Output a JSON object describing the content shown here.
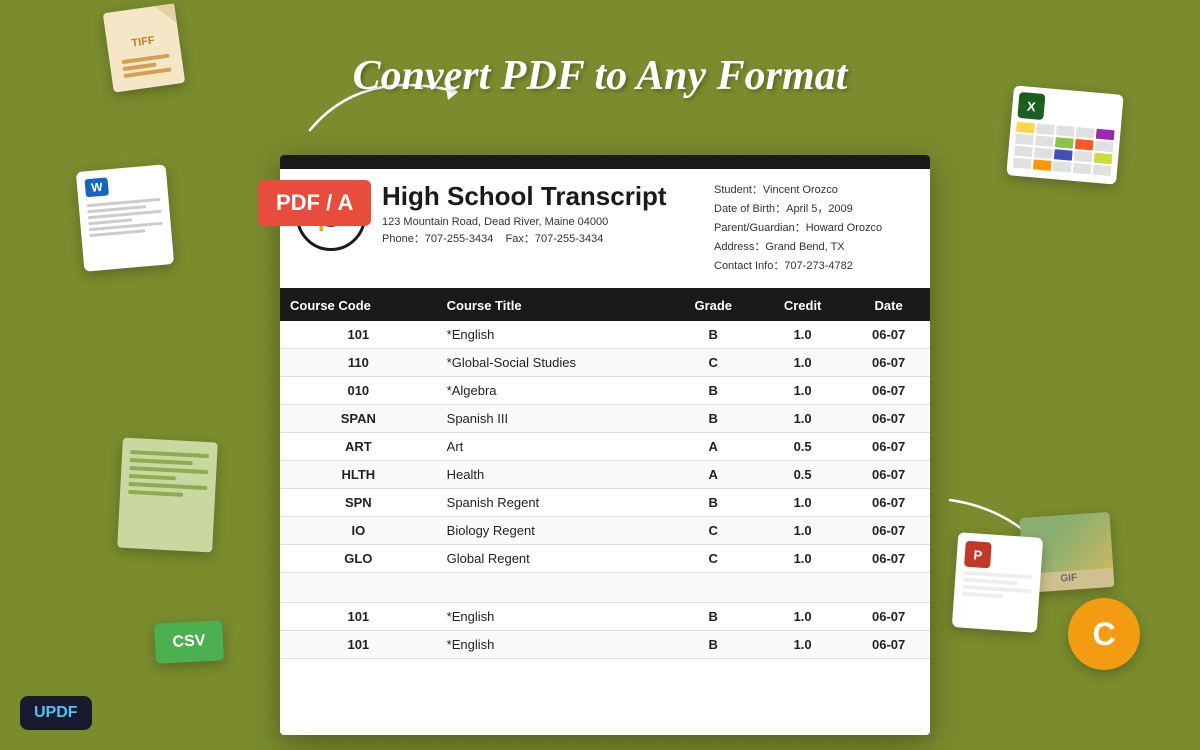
{
  "heading": "Convert PDF to Any Format",
  "pdf_badge": "PDF / A",
  "updf": "UPDF",
  "document": {
    "title": "High School Transcript",
    "address": "123 Mountain Road, Dead River, Maine 04000",
    "phone": "Phone：707-255-3434",
    "fax": "Fax：707-255-3434",
    "student": "Student：Vincent Orozco",
    "dob": "Date of Birth：April 5，2009",
    "parent": "Parent/Guardian：Howard Orozco",
    "address_info": "Address：Grand Bend, TX",
    "contact": "Contact Info：707-273-4782"
  },
  "table": {
    "headers": [
      "Course Code",
      "Course Title",
      "Grade",
      "Credit",
      "Date"
    ],
    "rows": [
      {
        "code": "101",
        "title": "*English",
        "grade": "B",
        "credit": "1.0",
        "date": "06-07"
      },
      {
        "code": "110",
        "title": "*Global-Social Studies",
        "grade": "C",
        "credit": "1.0",
        "date": "06-07"
      },
      {
        "code": "010",
        "title": "*Algebra",
        "grade": "B",
        "credit": "1.0",
        "date": "06-07"
      },
      {
        "code": "SPAN",
        "title": "Spanish III",
        "grade": "B",
        "credit": "1.0",
        "date": "06-07"
      },
      {
        "code": "ART",
        "title": "Art",
        "grade": "A",
        "credit": "0.5",
        "date": "06-07"
      },
      {
        "code": "HLTH",
        "title": "Health",
        "grade": "A",
        "credit": "0.5",
        "date": "06-07"
      },
      {
        "code": "SPN",
        "title": "Spanish Regent",
        "grade": "B",
        "credit": "1.0",
        "date": "06-07"
      },
      {
        "code": "IO",
        "title": "Biology Regent",
        "grade": "C",
        "credit": "1.0",
        "date": "06-07"
      },
      {
        "code": "GLO",
        "title": "Global Regent",
        "grade": "C",
        "credit": "1.0",
        "date": "06-07"
      },
      {
        "spacer": true
      },
      {
        "code": "101",
        "title": "*English",
        "grade": "B",
        "credit": "1.0",
        "date": "06-07"
      },
      {
        "code": "101",
        "title": "*English",
        "grade": "B",
        "credit": "1.0",
        "date": "06-07"
      }
    ]
  },
  "icons": {
    "tiff_label": "TIFF",
    "csv_label": "CSV",
    "x_label": "X",
    "word_label": "W",
    "ppt_label": "P",
    "c_label": "C",
    "gif_label": "GIF"
  },
  "spreadsheet_colors": [
    "#ffd54f",
    "#4caf50",
    "#2196f3",
    "#f44336",
    "#9c27b0",
    "#ff9800",
    "#00bcd4",
    "#8bc34a",
    "#ff5722",
    "#607d8b",
    "#795548",
    "#e91e63",
    "#3f51b5",
    "#009688",
    "#cddc39",
    "#ffeb3b",
    "#ff9800",
    "#f44336",
    "#4caf50",
    "#2196f3"
  ]
}
